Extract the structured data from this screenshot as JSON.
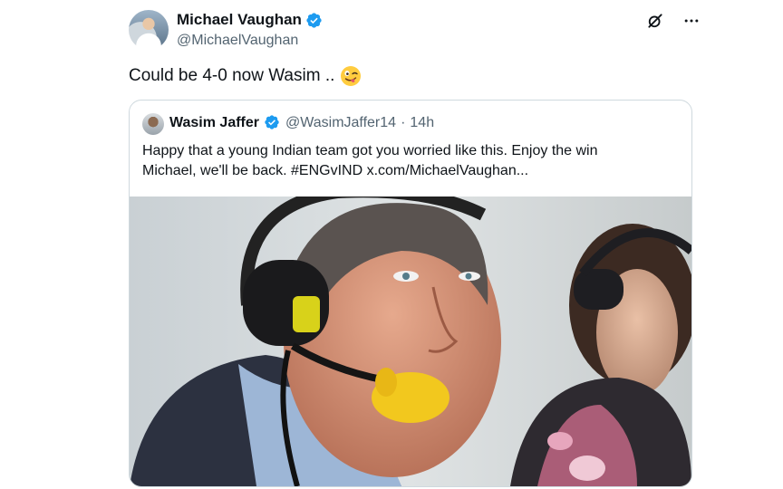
{
  "tweet": {
    "author_name": "Michael Vaughan",
    "author_handle": "@MichaelVaughan",
    "text": "Could be 4-0 now Wasim ..",
    "emoji": "zany-face"
  },
  "quoted_tweet": {
    "author_name": "Wasim Jaffer",
    "author_handle": "@WasimJaffer14",
    "separator": "·",
    "time": "14h",
    "text_line1": "Happy that a young Indian team got you worried like this. Enjoy the win",
    "text_line2": "Michael, we'll be back. #ENGvIND  x.com/MichaelVaughan..."
  },
  "icons": {
    "grok": "grok-icon",
    "more": "more-options-icon",
    "verified": "verified-badge-icon"
  },
  "colors": {
    "verified_blue": "#1d9bf0",
    "text": "#0f1419",
    "secondary_text": "#536471",
    "border": "#cfd9de"
  }
}
